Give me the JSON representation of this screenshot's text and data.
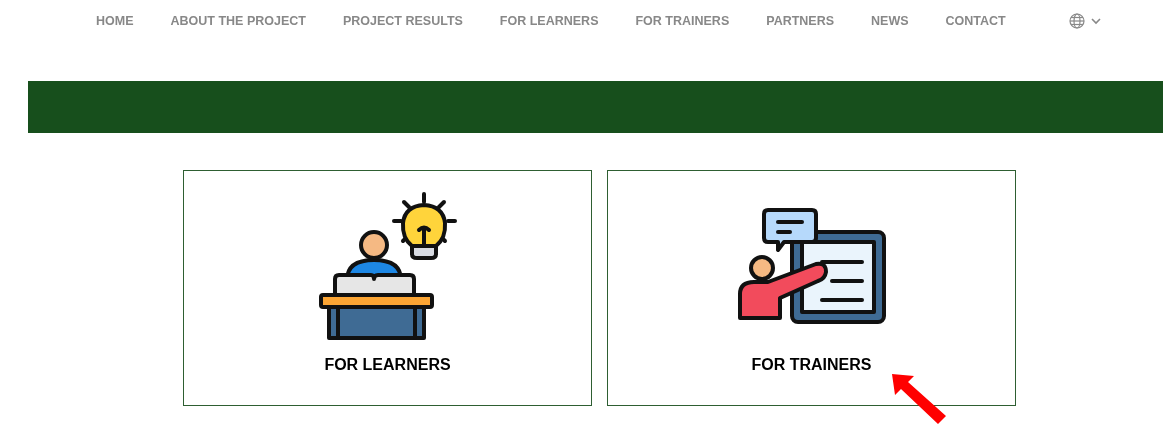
{
  "nav": {
    "items": [
      {
        "label": "HOME"
      },
      {
        "label": "ABOUT THE PROJECT"
      },
      {
        "label": "PROJECT RESULTS"
      },
      {
        "label": "FOR LEARNERS"
      },
      {
        "label": "FOR TRAINERS"
      },
      {
        "label": "PARTNERS"
      },
      {
        "label": "NEWS"
      },
      {
        "label": "CONTACT"
      }
    ]
  },
  "cards": [
    {
      "kind": "learner",
      "label": "FOR LEARNERS"
    },
    {
      "kind": "trainer",
      "label": "FOR TRAINERS"
    }
  ]
}
